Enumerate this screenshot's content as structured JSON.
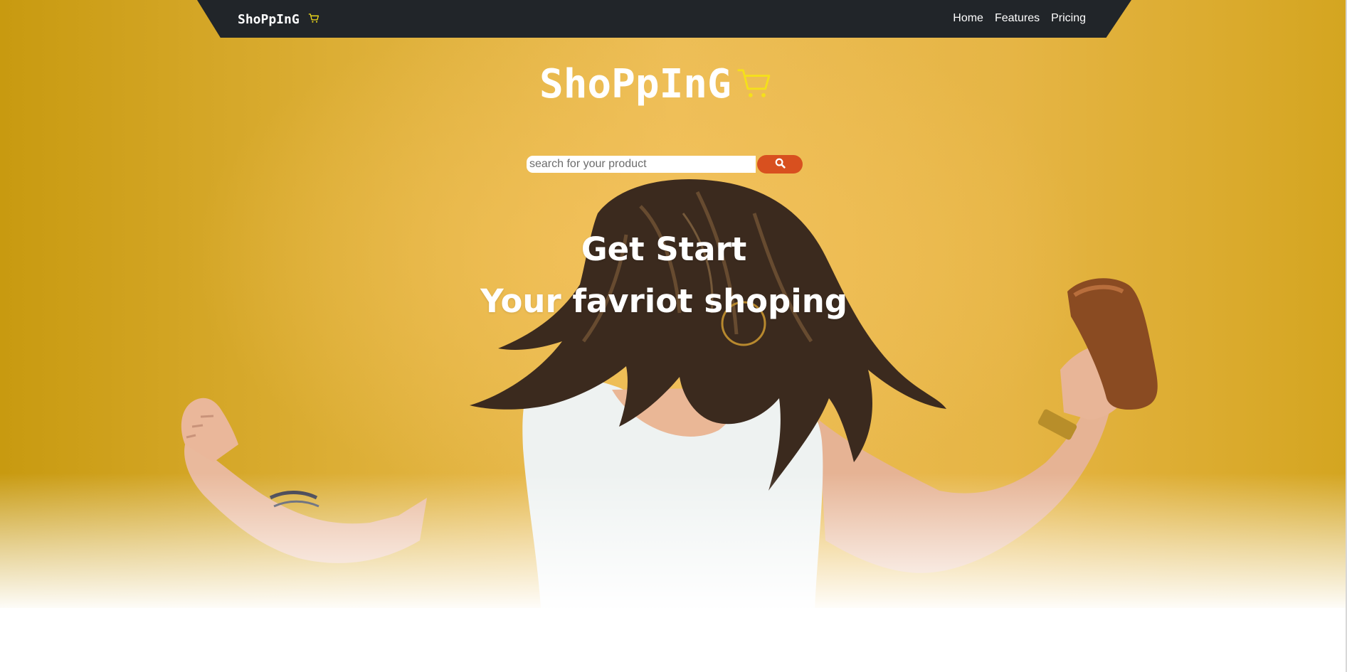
{
  "navbar": {
    "brand_label": "ShoPpInG",
    "brand_icon": "cart-icon",
    "links": [
      {
        "label": "Home"
      },
      {
        "label": "Features"
      },
      {
        "label": "Pricing"
      }
    ]
  },
  "hero": {
    "logo_text": "ShoPpInG",
    "logo_icon": "cart-icon",
    "search": {
      "placeholder": "search for your product",
      "value": "",
      "button_icon": "search-icon"
    },
    "headline_line1": "Get Start",
    "headline_line2": "Your favriot shoping",
    "image_icon": "woman-dancing-photo"
  },
  "colors": {
    "navbar_bg": "#212529",
    "hero_yellow": "#e0b03a",
    "cart_icon": "#f5e01a",
    "search_button": "#d8501f",
    "text_light": "#ffffff"
  }
}
